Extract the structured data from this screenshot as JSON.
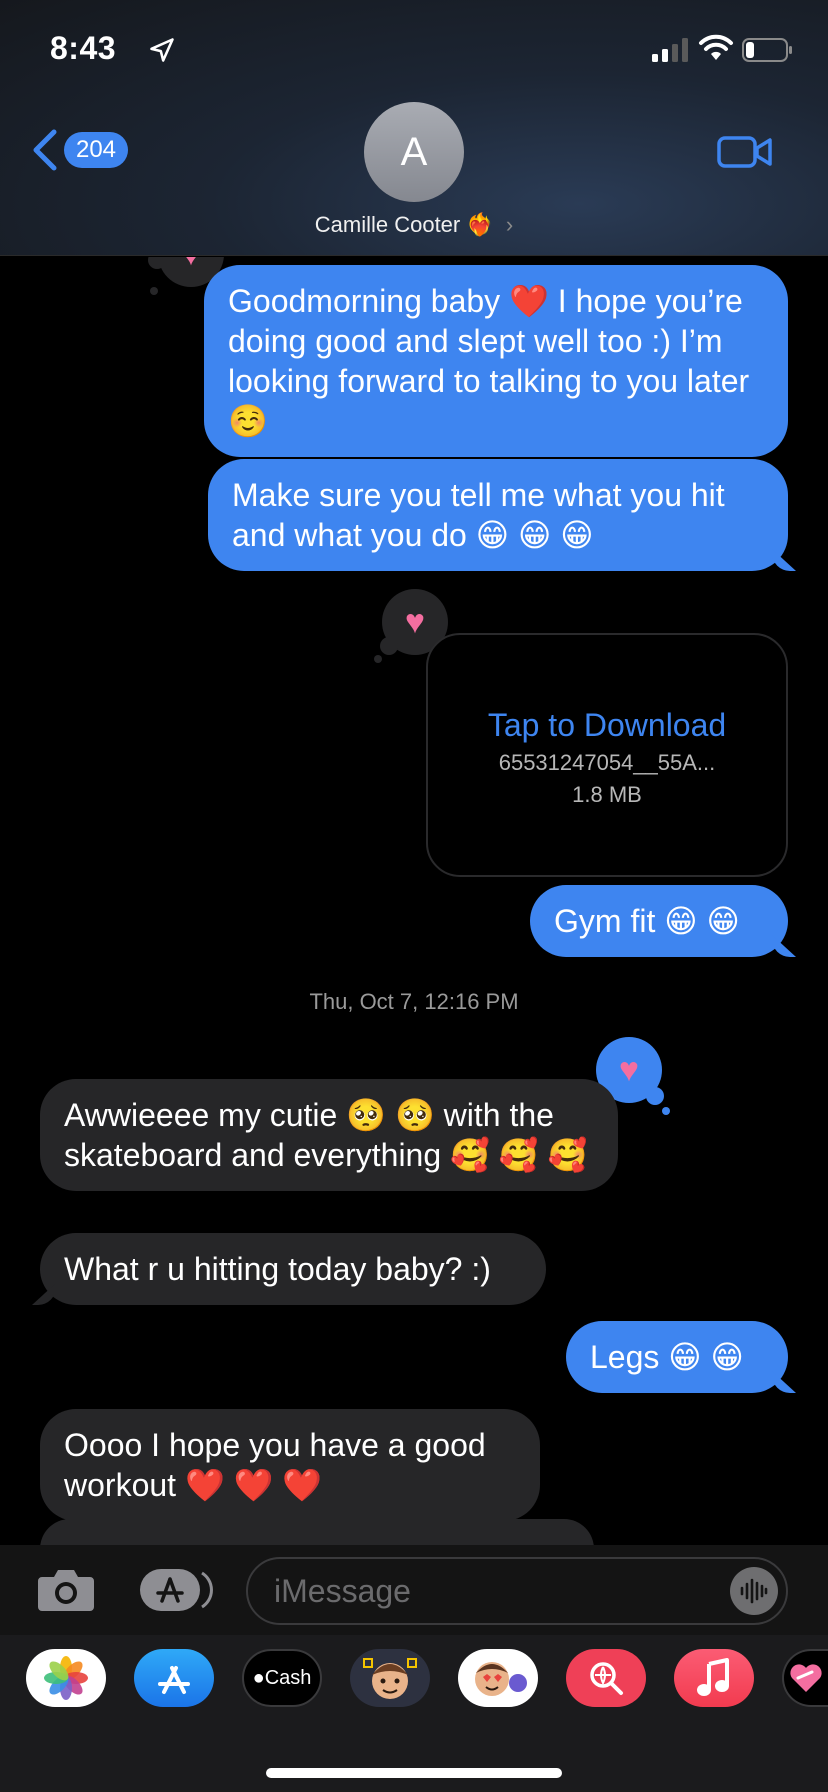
{
  "status_bar": {
    "time": "8:43",
    "icons": [
      "location-arrow-icon",
      "cellular-signal-icon",
      "wifi-icon",
      "battery-icon"
    ]
  },
  "header": {
    "back_count": "204",
    "avatar_initial": "A",
    "contact_name": "Camille Cooter",
    "contact_emoji": "❤️‍🔥",
    "contact_chevron": "›",
    "icons": [
      "back-chevron-icon",
      "video-camera-icon"
    ]
  },
  "messages": [
    {
      "from": "me",
      "text": "Goodmorning baby ❤️ I hope you’re doing good and slept well too :) I’m looking forward to talking to you later ☺️",
      "tapback": "heart"
    },
    {
      "from": "me",
      "text": "Make sure you tell me what you hit and what you do 😁 😁 😁"
    },
    {
      "from": "me",
      "type": "attachment",
      "title": "Tap to Download",
      "filename": "65531247054__55A...",
      "size": "1.8 MB",
      "tapback": "heart"
    },
    {
      "from": "me",
      "text": "Gym fit 😁 😁"
    },
    {
      "type": "timestamp",
      "day": "Thu, Oct 7,",
      "time": "12:16 PM"
    },
    {
      "from": "them",
      "text": "Awwieeee my cutie 🥺 🥺 with the skateboard and everything 🥰 🥰 🥰",
      "tapback": "heart"
    },
    {
      "from": "them",
      "text": "What r u hitting today baby? :)"
    },
    {
      "from": "me",
      "text": "Legs 😁 😁"
    },
    {
      "from": "them",
      "text": "Oooo I hope you have a good workout ❤️ ❤️ ❤️"
    }
  ],
  "tapback_glyph": "♥",
  "input_bar": {
    "placeholder": "iMessage",
    "icons": [
      "camera-icon",
      "app-store-icon",
      "audio-waveform-icon"
    ]
  },
  "app_drawer": {
    "apps": [
      {
        "name": "Photos",
        "icon": "photos-icon"
      },
      {
        "name": "App Store",
        "icon": "app-store-icon"
      },
      {
        "name": "Cash",
        "label": "Cash",
        "icon": "apple-cash-icon"
      },
      {
        "name": "Memoji",
        "icon": "memoji-icon"
      },
      {
        "name": "Memoji Stickers",
        "icon": "memoji-stickers-icon"
      },
      {
        "name": "Images",
        "icon": "image-search-icon"
      },
      {
        "name": "Music",
        "icon": "music-icon"
      },
      {
        "name": "Digital Touch",
        "icon": "digital-touch-icon"
      }
    ]
  },
  "colors": {
    "sent_bubble": "#3e85f0",
    "received_bubble": "#262628",
    "background": "#000000",
    "tapback_heart": "#f46ea0",
    "accent": "#3e85f0"
  }
}
